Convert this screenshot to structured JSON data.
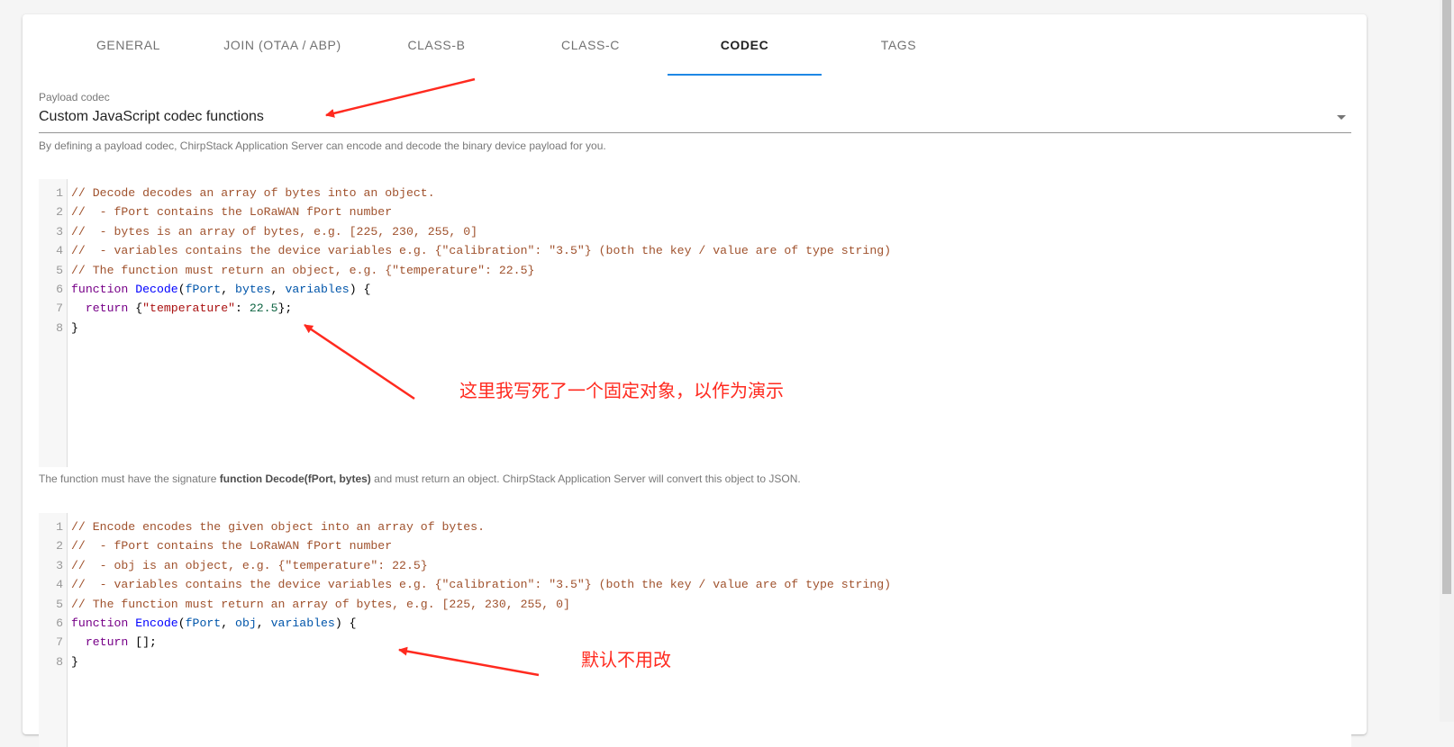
{
  "tabs": [
    {
      "label": "GENERAL",
      "active": false
    },
    {
      "label": "JOIN (OTAA / ABP)",
      "active": false
    },
    {
      "label": "CLASS-B",
      "active": false
    },
    {
      "label": "CLASS-C",
      "active": false
    },
    {
      "label": "CODEC",
      "active": true
    },
    {
      "label": "TAGS",
      "active": false
    }
  ],
  "codec": {
    "label": "Payload codec",
    "value": "Custom JavaScript codec functions",
    "helper": "By defining a payload codec, ChirpStack Application Server can encode and decode the binary device payload for you."
  },
  "decode_helper": {
    "pre": "The function must have the signature ",
    "bold": "function Decode(fPort, bytes)",
    "post": " and must return an object. ChirpStack Application Server will convert this object to JSON."
  },
  "decode_editor": {
    "line_numbers": [
      "1",
      "2",
      "3",
      "4",
      "5",
      "6",
      "7",
      "8"
    ],
    "lines": [
      [
        {
          "t": "comment",
          "v": "// Decode decodes an array of bytes into an object."
        }
      ],
      [
        {
          "t": "comment",
          "v": "//  - fPort contains the LoRaWAN fPort number"
        }
      ],
      [
        {
          "t": "comment",
          "v": "//  - bytes is an array of bytes, e.g. [225, 230, 255, 0]"
        }
      ],
      [
        {
          "t": "comment",
          "v": "//  - variables contains the device variables e.g. {\"calibration\": \"3.5\"} (both the key / value are of type string)"
        }
      ],
      [
        {
          "t": "comment",
          "v": "// The function must return an object, e.g. {\"temperature\": 22.5}"
        }
      ],
      [
        {
          "t": "kw",
          "v": "function"
        },
        {
          "t": "txt",
          "v": " "
        },
        {
          "t": "def",
          "v": "Decode"
        },
        {
          "t": "txt",
          "v": "("
        },
        {
          "t": "var",
          "v": "fPort"
        },
        {
          "t": "txt",
          "v": ", "
        },
        {
          "t": "var",
          "v": "bytes"
        },
        {
          "t": "txt",
          "v": ", "
        },
        {
          "t": "var",
          "v": "variables"
        },
        {
          "t": "txt",
          "v": ") {"
        }
      ],
      [
        {
          "t": "txt",
          "v": "  "
        },
        {
          "t": "kw",
          "v": "return"
        },
        {
          "t": "txt",
          "v": " {"
        },
        {
          "t": "str",
          "v": "\"temperature\""
        },
        {
          "t": "txt",
          "v": ": "
        },
        {
          "t": "num",
          "v": "22.5"
        },
        {
          "t": "txt",
          "v": "};"
        }
      ],
      [
        {
          "t": "txt",
          "v": "}"
        }
      ]
    ]
  },
  "encode_editor": {
    "line_numbers": [
      "1",
      "2",
      "3",
      "4",
      "5",
      "6",
      "7",
      "8"
    ],
    "lines": [
      [
        {
          "t": "comment",
          "v": "// Encode encodes the given object into an array of bytes."
        }
      ],
      [
        {
          "t": "comment",
          "v": "//  - fPort contains the LoRaWAN fPort number"
        }
      ],
      [
        {
          "t": "comment",
          "v": "//  - obj is an object, e.g. {\"temperature\": 22.5}"
        }
      ],
      [
        {
          "t": "comment",
          "v": "//  - variables contains the device variables e.g. {\"calibration\": \"3.5\"} (both the key / value are of type string)"
        }
      ],
      [
        {
          "t": "comment",
          "v": "// The function must return an array of bytes, e.g. [225, 230, 255, 0]"
        }
      ],
      [
        {
          "t": "kw",
          "v": "function"
        },
        {
          "t": "txt",
          "v": " "
        },
        {
          "t": "def",
          "v": "Encode"
        },
        {
          "t": "txt",
          "v": "("
        },
        {
          "t": "var",
          "v": "fPort"
        },
        {
          "t": "txt",
          "v": ", "
        },
        {
          "t": "var",
          "v": "obj"
        },
        {
          "t": "txt",
          "v": ", "
        },
        {
          "t": "var",
          "v": "variables"
        },
        {
          "t": "txt",
          "v": ") {"
        }
      ],
      [
        {
          "t": "txt",
          "v": "  "
        },
        {
          "t": "kw",
          "v": "return"
        },
        {
          "t": "txt",
          "v": " [];"
        }
      ],
      [
        {
          "t": "txt",
          "v": "}"
        }
      ]
    ]
  },
  "annotations": {
    "decode_note": "这里我写死了一个固定对象，以作为演示",
    "encode_note": "默认不用改"
  },
  "colors": {
    "accent": "#1e88e5",
    "annotation": "#ff2a1f"
  }
}
